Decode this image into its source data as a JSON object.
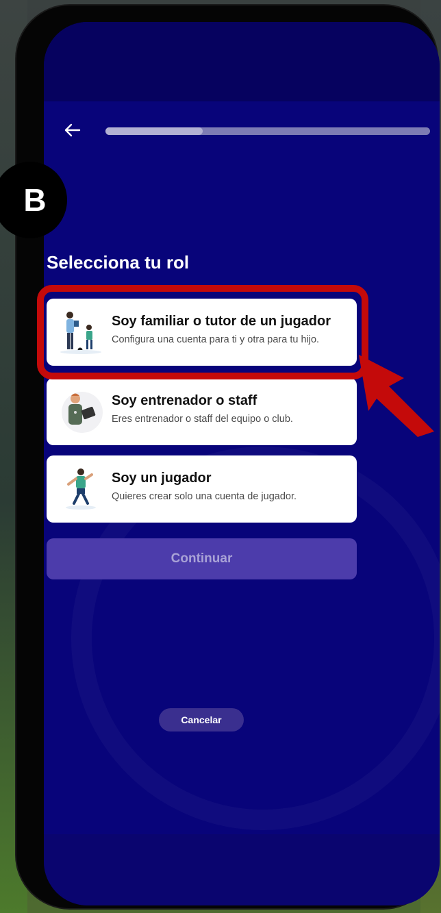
{
  "badge": {
    "letter": "B"
  },
  "header": {
    "back_icon": "arrow-left-icon",
    "progress_fraction": 0.3
  },
  "main": {
    "title": "Selecciona tu rol",
    "roles": [
      {
        "title": "Soy familiar o tutor de un jugador",
        "description": "Configura una cuenta para ti y otra para tu hijo.",
        "icon": "parent-and-child-illustration",
        "highlighted": true
      },
      {
        "title": "Soy entrenador o staff",
        "description": "Eres entrenador o staff del equipo o club.",
        "icon": "coach-with-clipboard-illustration",
        "highlighted": false
      },
      {
        "title": "Soy un jugador",
        "description": "Quieres crear solo una cuenta de jugador.",
        "icon": "soccer-player-illustration",
        "highlighted": false
      }
    ],
    "continue_label": "Continuar",
    "cancel_label": "Cancelar"
  },
  "colors": {
    "screen_bg": "#08047a",
    "highlight_red": "#c40a0a",
    "button_purple": "#4c3cab"
  }
}
